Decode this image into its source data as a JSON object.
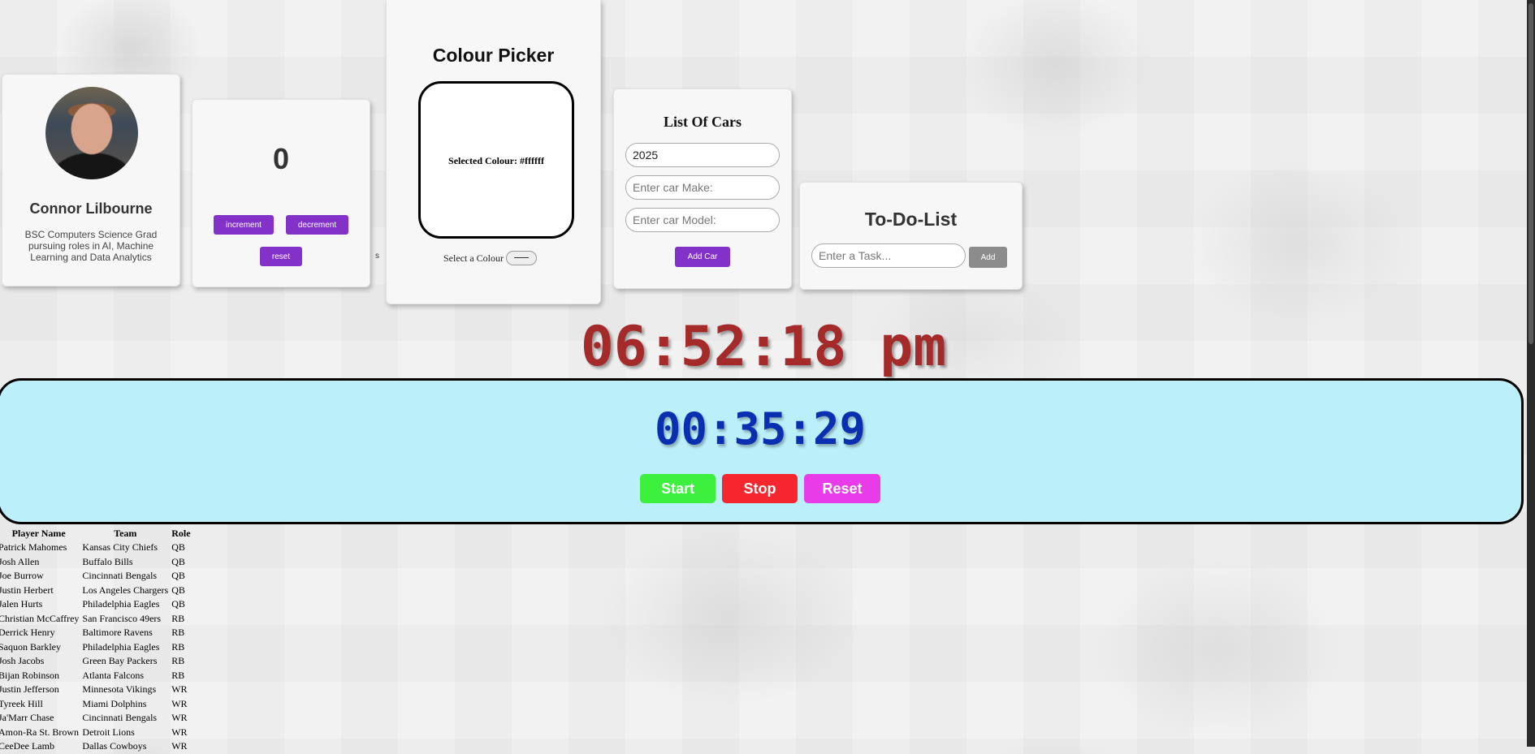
{
  "profile": {
    "name": "Connor Lilbourne",
    "bio": "BSC Computers Science Grad pursuing roles in AI, Machine Learning and Data Analytics"
  },
  "counter": {
    "value": "0",
    "increment_label": "increment",
    "decrement_label": "decrement",
    "reset_label": "reset",
    "stray_text": "s"
  },
  "colour_picker": {
    "title": "Colour Picker",
    "selected_text": "Selected Colour: #ffffff",
    "selected_color": "#ffffff",
    "select_label": "Select a Colour"
  },
  "cars": {
    "title": "List Of Cars",
    "year_value": "2025",
    "make_placeholder": "Enter car Make:",
    "model_placeholder": "Enter car Model:",
    "add_label": "Add Car"
  },
  "todo": {
    "title": "To-Do-List",
    "task_placeholder": "Enter a Task...",
    "add_label": "Add"
  },
  "clock": {
    "time": "06:52:18 pm"
  },
  "stopwatch": {
    "time": "00:35:29",
    "start_label": "Start",
    "stop_label": "Stop",
    "reset_label": "Reset"
  },
  "players_table": {
    "headers": [
      "Player Name",
      "Team",
      "Role"
    ],
    "rows": [
      [
        "Patrick Mahomes",
        "Kansas City Chiefs",
        "QB"
      ],
      [
        "Josh Allen",
        "Buffalo Bills",
        "QB"
      ],
      [
        "Joe Burrow",
        "Cincinnati Bengals",
        "QB"
      ],
      [
        "Justin Herbert",
        "Los Angeles Chargers",
        "QB"
      ],
      [
        "Jalen Hurts",
        "Philadelphia Eagles",
        "QB"
      ],
      [
        "Christian McCaffrey",
        "San Francisco 49ers",
        "RB"
      ],
      [
        "Derrick Henry",
        "Baltimore Ravens",
        "RB"
      ],
      [
        "Saquon Barkley",
        "Philadelphia Eagles",
        "RB"
      ],
      [
        "Josh Jacobs",
        "Green Bay Packers",
        "RB"
      ],
      [
        "Bijan Robinson",
        "Atlanta Falcons",
        "RB"
      ],
      [
        "Justin Jefferson",
        "Minnesota Vikings",
        "WR"
      ],
      [
        "Tyreek Hill",
        "Miami Dolphins",
        "WR"
      ],
      [
        "Ja'Marr Chase",
        "Cincinnati Bengals",
        "WR"
      ],
      [
        "Amon-Ra St. Brown",
        "Detroit Lions",
        "WR"
      ],
      [
        "CeeDee Lamb",
        "Dallas Cowboys",
        "WR"
      ]
    ]
  }
}
